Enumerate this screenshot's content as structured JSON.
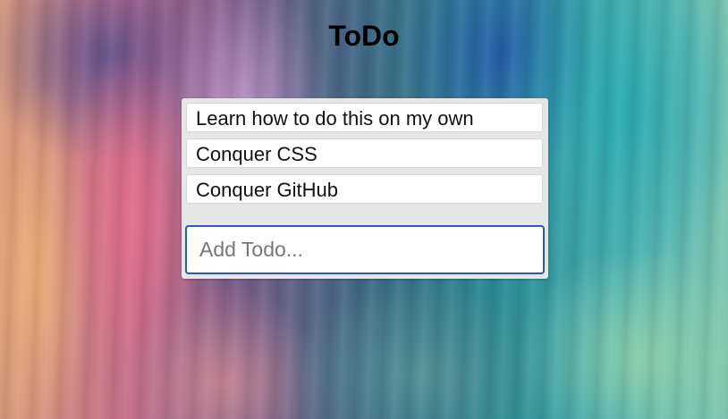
{
  "app": {
    "title": "ToDo"
  },
  "todos": [
    {
      "text": "Learn how to do this on my own"
    },
    {
      "text": "Conquer CSS"
    },
    {
      "text": "Conquer GitHub"
    }
  ],
  "add_form": {
    "placeholder": "Add Todo...",
    "value": "",
    "stray_mark": ","
  },
  "colors": {
    "input_border": "#2a5bb4",
    "panel_bg": "#e6e6e6",
    "item_bg": "#ffffff"
  }
}
